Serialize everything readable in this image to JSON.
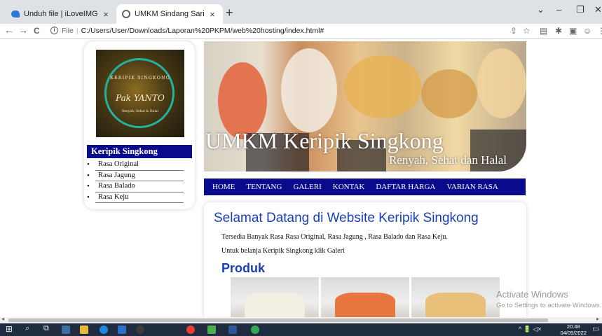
{
  "browser": {
    "tabs": [
      {
        "title": "Unduh file | iLoveIMG",
        "icon": "iloveimg-favicon-icon",
        "active": false
      },
      {
        "title": "UMKM Sindang Sari",
        "icon": "globe-icon",
        "active": true
      }
    ],
    "new_tab": "+",
    "window_controls": {
      "collapse": "⌄",
      "minimize": "–",
      "maximize": "❐",
      "close": "✕"
    },
    "nav": {
      "back": "←",
      "forward": "→",
      "reload": "C"
    },
    "address": {
      "file_label": "File",
      "url": "C:/Users/User/Downloads/Laporan%20PKPM/web%20hosting/index.html#"
    }
  },
  "page": {
    "sidebar": {
      "logo": {
        "line1": "KERIPIK SINGKONG",
        "line2": "Pak YANTO",
        "line3": "Renyah, Sehat & Halal"
      },
      "title": "Keripik Singkong",
      "items": [
        "Rasa Original",
        "Rasa Jagung",
        "Rasa Balado",
        "Rasa Keju"
      ]
    },
    "banner": {
      "title": "UMKM Keripik Singkong",
      "subtitle": "Renyah, Sehat dan Halal"
    },
    "menu": [
      "HOME",
      "TENTANG",
      "GALERI",
      "KONTAK",
      "DAFTAR HARGA",
      "VARIAN RASA"
    ],
    "content": {
      "heading": "Selamat Datang di Website Keripik Singkong",
      "para1": "Tersedia Banyak Rasa Rasa Original, Rasa Jagung , Rasa Balado dan Rasa Keju.",
      "para2": "Untuk belanja Keripik Singkong klik Galeri",
      "products_heading": "Produk"
    }
  },
  "watermark": {
    "line1": "Activate Windows",
    "line2": "Go to Settings to activate Windows."
  },
  "taskbar": {
    "time": "20:48",
    "date": "04/09/2022",
    "tray": "^ 🔋 ◁×"
  },
  "colors": {
    "nav_blue": "#0a0a8c",
    "heading_blue": "#1a3fb8",
    "tab_bar": "#dee1e6",
    "taskbar": "#1f2b3e"
  }
}
